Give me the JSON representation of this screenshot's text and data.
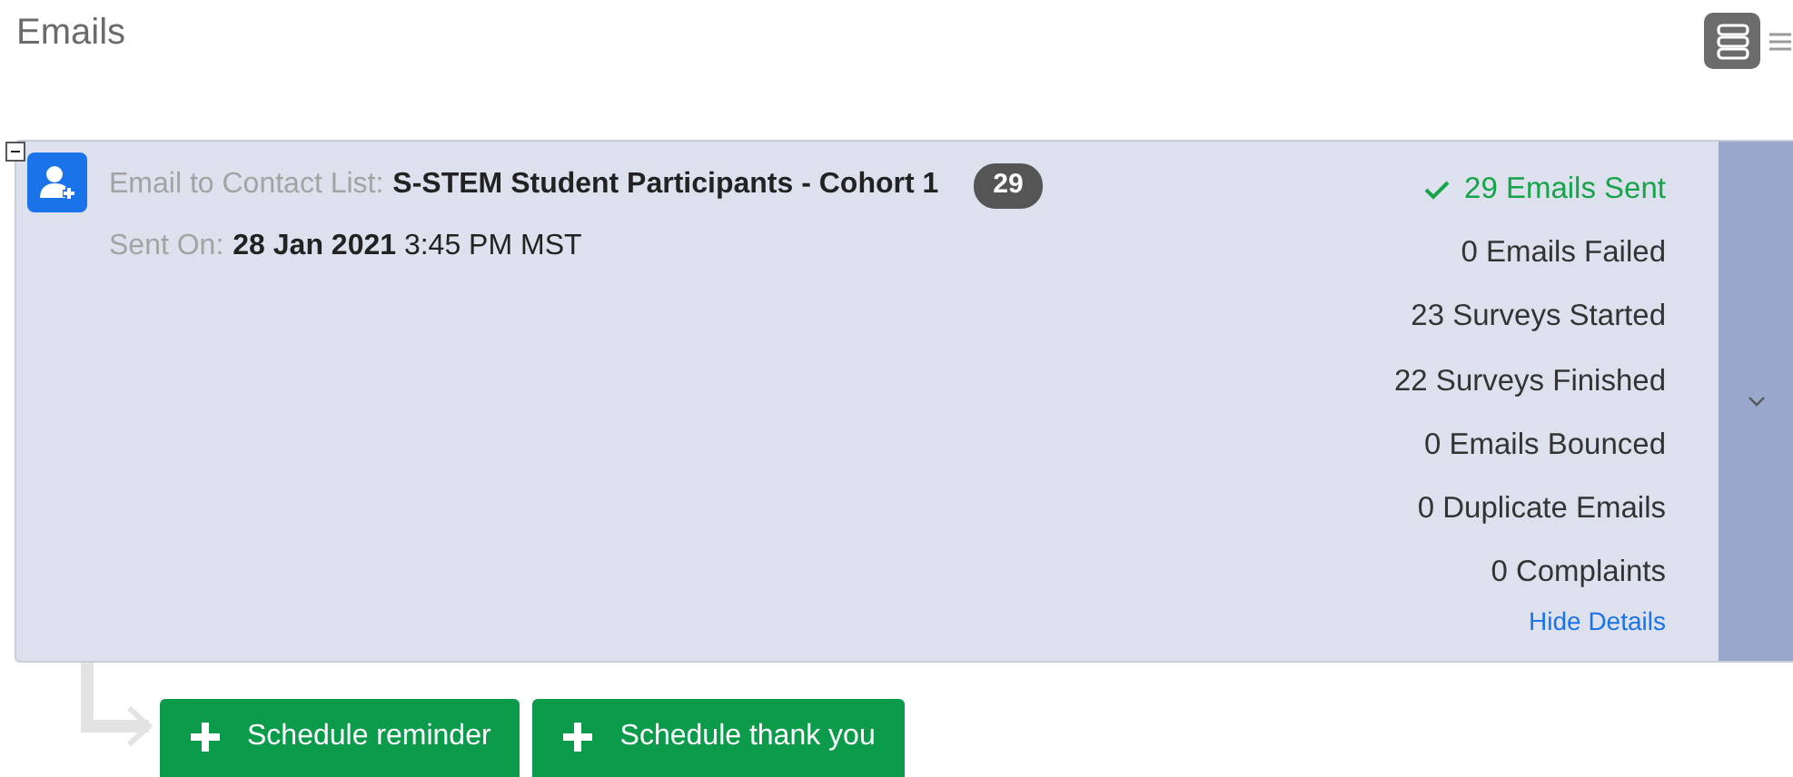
{
  "title": "Emails",
  "view_options": [
    {
      "kind": "cards",
      "selected": true
    },
    {
      "kind": "list",
      "selected": false
    }
  ],
  "distribution": {
    "expanded": true,
    "label": "Email to Contact List:",
    "list_name": "S-STEM Student Participants - Cohort 1",
    "count": "29",
    "sent_label": "Sent On:",
    "sent_value": "**28 Jan 2021** 3:45 PM MST",
    "stats": [
      {
        "kind": "success",
        "text": "29 Emails Sent"
      },
      {
        "kind": "plain",
        "text": "0 Emails Failed"
      },
      {
        "kind": "plain",
        "text": "23 Surveys Started"
      },
      {
        "kind": "plain",
        "text": "22 Surveys Finished"
      },
      {
        "kind": "plain",
        "text": "0 Emails Bounced"
      },
      {
        "kind": "plain",
        "text": "0 Duplicate Emails"
      },
      {
        "kind": "plain",
        "text": "0 Complaints"
      }
    ],
    "details_link": "Hide Details"
  },
  "actions": [
    "Schedule reminder",
    "Schedule thank you"
  ]
}
